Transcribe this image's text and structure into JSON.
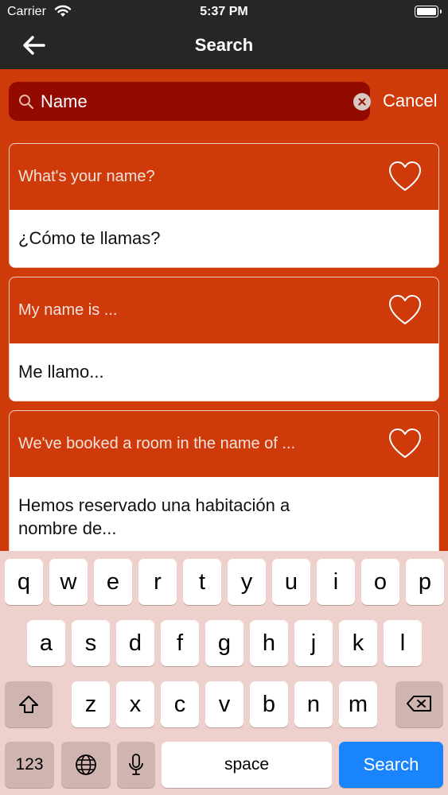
{
  "status_bar": {
    "carrier": "Carrier",
    "time": "5:37 PM"
  },
  "nav": {
    "title": "Search"
  },
  "search": {
    "value": "Name",
    "placeholder": "",
    "cancel_label": "Cancel"
  },
  "results": [
    {
      "english": "What's your name?",
      "spanish": "¿Cómo te llamas?"
    },
    {
      "english": "My name is ...",
      "spanish": "Me llamo..."
    },
    {
      "english": "We've booked a room in the name of ...",
      "spanish_line1": "Hemos reservado una habitación a",
      "spanish_line2": "nombre de..."
    }
  ],
  "keyboard": {
    "row1": [
      "q",
      "w",
      "e",
      "r",
      "t",
      "y",
      "u",
      "i",
      "o",
      "p"
    ],
    "row2": [
      "a",
      "s",
      "d",
      "f",
      "g",
      "h",
      "j",
      "k",
      "l"
    ],
    "row3": [
      "z",
      "x",
      "c",
      "v",
      "b",
      "n",
      "m"
    ],
    "numbers_label": "123",
    "space_label": "space",
    "return_label": "Search"
  },
  "colors": {
    "brand": "#cf3a0b",
    "search_field": "#930b00",
    "bar": "#262626",
    "keyboard": "#eed1cc",
    "return_key": "#1a84ff"
  },
  "icons": [
    "wifi-icon",
    "battery-icon",
    "back-arrow-icon",
    "search-icon",
    "clear-icon",
    "heart-icon",
    "shift-icon",
    "delete-icon",
    "globe-icon",
    "microphone-icon"
  ]
}
